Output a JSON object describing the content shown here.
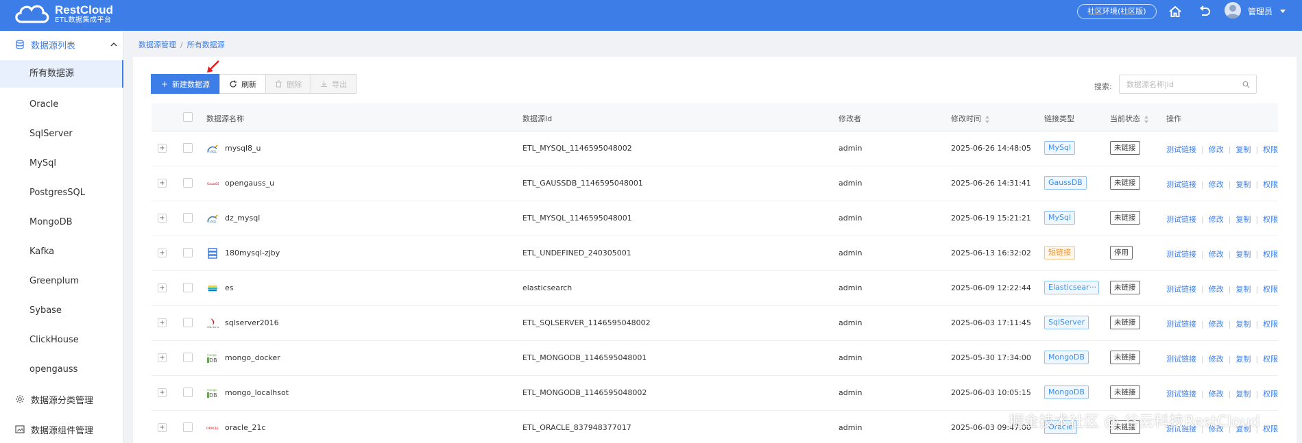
{
  "header": {
    "logo_title": "RestCloud",
    "logo_subtitle": "ETL数据集成平台",
    "env_button": "社区环境(社区版)",
    "user_name": "管理员"
  },
  "sidebar": {
    "group1_label": "数据源列表",
    "items": [
      {
        "label": "所有数据源",
        "selected": true
      },
      {
        "label": "Oracle"
      },
      {
        "label": "SqlServer"
      },
      {
        "label": "MySql"
      },
      {
        "label": "PostgresSQL"
      },
      {
        "label": "MongoDB"
      },
      {
        "label": "Kafka"
      },
      {
        "label": "Greenplum"
      },
      {
        "label": "Sybase"
      },
      {
        "label": "ClickHouse"
      },
      {
        "label": "opengauss"
      }
    ],
    "group2_label": "数据源分类管理",
    "group3_label": "数据源组件管理"
  },
  "breadcrumb": {
    "root": "数据源管理",
    "sep": "/",
    "current": "所有数据源"
  },
  "toolbar": {
    "new_label": "新建数据源",
    "refresh_label": "刷新",
    "delete_label": "删除",
    "export_label": "导出",
    "search_label": "搜索:",
    "search_placeholder": "数据源名称|Id"
  },
  "table": {
    "headers": {
      "name": "数据源名称",
      "id": "数据源Id",
      "modifier": "修改者",
      "time": "修改时间",
      "type": "链接类型",
      "status": "当前状态",
      "ops": "操作"
    },
    "ops_labels": {
      "test": "测试链接",
      "edit": "修改",
      "copy": "复制",
      "perm": "权限"
    },
    "rows": [
      {
        "name": "mysql8_u",
        "id": "ETL_MYSQL_1146595048002",
        "modifier": "admin",
        "time": "2025-06-26 14:48:05",
        "type": "MySql",
        "status": "未链接",
        "icon": "mysql-icon",
        "warn": false
      },
      {
        "name": "opengauss_u",
        "id": "ETL_GAUSSDB_1146595048001",
        "modifier": "admin",
        "time": "2025-06-26 14:31:41",
        "type": "GaussDB",
        "status": "未链接",
        "icon": "gaussdb-icon",
        "warn": false
      },
      {
        "name": "dz_mysql",
        "id": "ETL_MYSQL_1146595048001",
        "modifier": "admin",
        "time": "2025-06-19 15:21:21",
        "type": "MySql",
        "status": "未链接",
        "icon": "mysql-icon",
        "warn": false
      },
      {
        "name": "180mysql-zjby",
        "id": "ETL_UNDEFINED_240305001",
        "modifier": "admin",
        "time": "2025-06-13 16:32:02",
        "type": "短链接",
        "status": "停用",
        "icon": "server-icon",
        "warn": true
      },
      {
        "name": "es",
        "id": "elasticsearch",
        "modifier": "admin",
        "time": "2025-06-09 12:22:44",
        "type": "Elasticsear···",
        "status": "未链接",
        "icon": "elasticsearch-icon",
        "warn": false
      },
      {
        "name": "sqlserver2016",
        "id": "ETL_SQLSERVER_1146595048002",
        "modifier": "admin",
        "time": "2025-06-03 17:11:45",
        "type": "SqlServer",
        "status": "未链接",
        "icon": "sqlserver-icon",
        "warn": false
      },
      {
        "name": "mongo_docker",
        "id": "ETL_MONGODB_1146595048001",
        "modifier": "admin",
        "time": "2025-05-30 17:34:00",
        "type": "MongoDB",
        "status": "未链接",
        "icon": "mongodb-icon",
        "warn": false
      },
      {
        "name": "mongo_localhsot",
        "id": "ETL_MONGODB_1146595048002",
        "modifier": "admin",
        "time": "2025-06-03 10:05:15",
        "type": "MongoDB",
        "status": "未链接",
        "icon": "mongodb-icon",
        "warn": false
      },
      {
        "name": "oracle_21c",
        "id": "ETL_ORACLE_837948377017",
        "modifier": "admin",
        "time": "2025-06-03 09:47:00",
        "type": "Oracle",
        "status": "未链接",
        "icon": "oracle-icon",
        "warn": false
      }
    ]
  },
  "watermark": "掘金技术社区 @ 谷云科技RestCloud",
  "colors": {
    "primary": "#3d7de8",
    "tag_border": "#91c3f5",
    "warn": "#f0932b"
  }
}
